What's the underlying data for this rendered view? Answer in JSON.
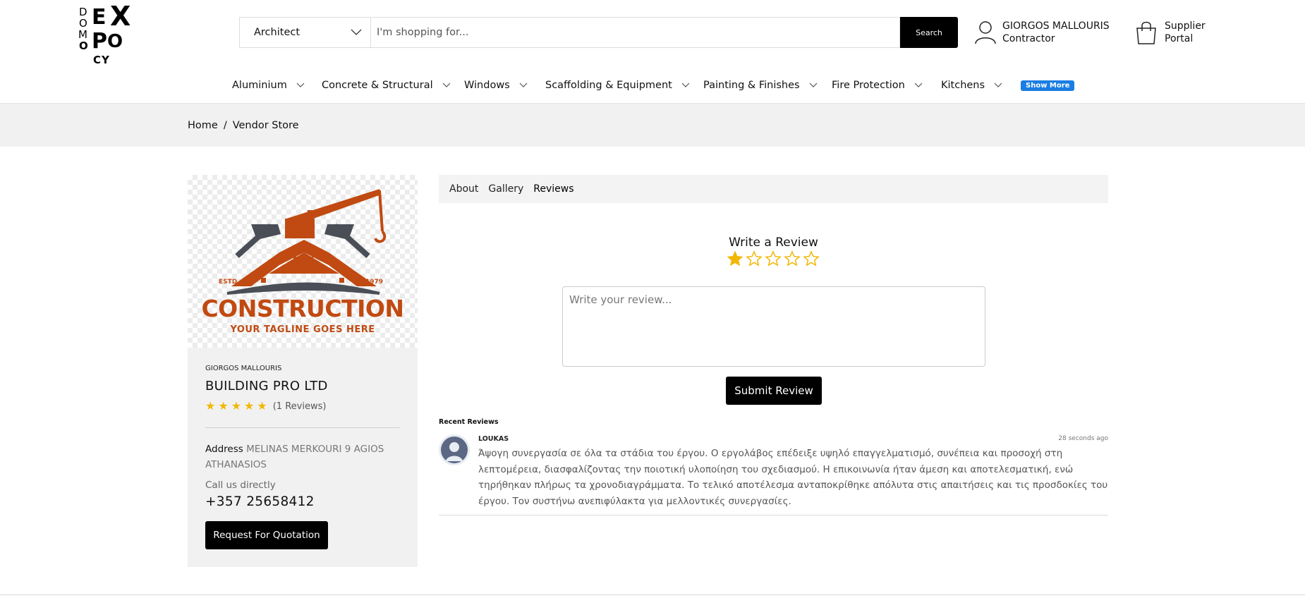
{
  "logo": {
    "letters": {
      "d": "D",
      "o": "O",
      "m": "M",
      "o2": "O",
      "e": "E",
      "x": "X",
      "p": "P",
      "o3": "O",
      "cy": "CY"
    }
  },
  "search": {
    "category": "Architect",
    "placeholder": "I'm shopping for...",
    "button": "Search"
  },
  "user": {
    "name": "GIORGOS MALLOURIS",
    "role": "Contractor"
  },
  "supplier": {
    "line1": "Supplier",
    "line2": "Portal"
  },
  "nav": {
    "items": [
      {
        "label": "Aluminium"
      },
      {
        "label": "Concrete & Structural"
      },
      {
        "label": "Windows"
      },
      {
        "label": "Scaffolding & Equipment"
      },
      {
        "label": "Painting & Finishes"
      },
      {
        "label": "Fire Protection"
      },
      {
        "label": "Kitchens"
      }
    ],
    "show_more": "Show More"
  },
  "breadcrumb": {
    "home": "Home",
    "separator": "/",
    "current": "Vendor Store"
  },
  "vendor": {
    "logo": {
      "estd": "ESTD",
      "year": "1979",
      "title": "CONSTRUCTION",
      "tagline": "YOUR TAGLINE GOES HERE"
    },
    "owner": "GIORGOS MALLOURIS",
    "company": "BUILDING PRO LTD",
    "rating": 5,
    "reviews_count": "(1 Reviews)",
    "address_label": "Address",
    "address": "MELINAS MERKOURI 9 AGIOS ATHANASIOS",
    "call_label": "Call us directly",
    "phone": "+357 25658412",
    "rfq_button": "Request For Quotation"
  },
  "tabs": [
    {
      "label": "About"
    },
    {
      "label": "Gallery"
    },
    {
      "label": "Reviews",
      "active": true
    }
  ],
  "review_form": {
    "title": "Write a Review",
    "selected_stars": 1,
    "max_stars": 5,
    "placeholder": "Write your review...",
    "submit": "Submit Review"
  },
  "recent": {
    "label": "Recent Reviews",
    "items": [
      {
        "name": "LOUKAS",
        "time": "28 seconds ago",
        "text": "Άψογη συνεργασία σε όλα τα στάδια του έργου. Ο εργολάβος επέδειξε υψηλό επαγγελματισμό, συνέπεια και προσοχή στη λεπτομέρεια, διασφαλίζοντας την ποιοτική υλοποίηση του σχεδιασμού. Η επικοινωνία ήταν άμεση και αποτελεσματική, ενώ τηρήθηκαν πλήρως τα χρονοδιαγράμματα. Το τελικό αποτέλεσμα ανταποκρίθηκε απόλυτα στις απαιτήσεις και τις προσδοκίες του έργου. Τον συστήνω ανεπιφύλακτα για μελλοντικές συνεργασίες."
      }
    ]
  },
  "colors": {
    "accent": "#1a7de3",
    "brand_orange": "#c04a12",
    "star": "#f2b705"
  }
}
